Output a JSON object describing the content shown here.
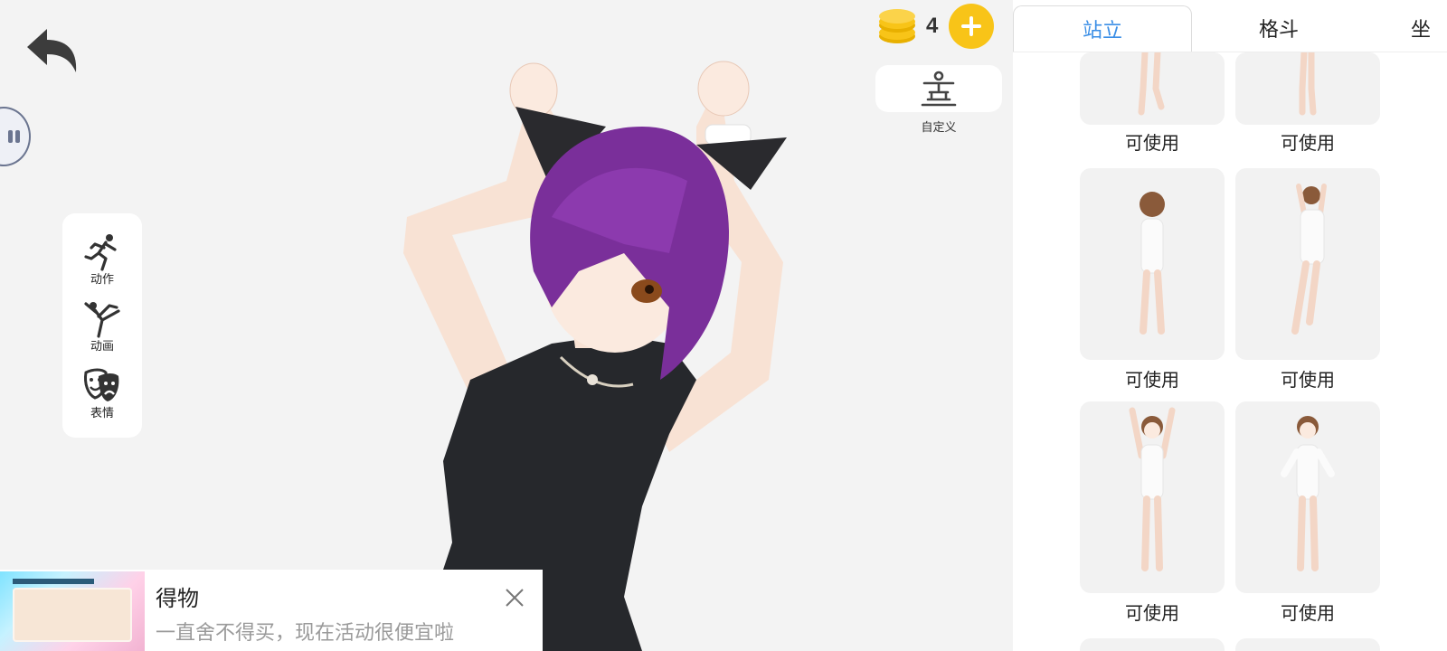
{
  "toolbar": {
    "items": [
      {
        "label": "动作",
        "icon": "running-figure-icon"
      },
      {
        "label": "动画",
        "icon": "dancing-figure-icon"
      },
      {
        "label": "表情",
        "icon": "theater-mask-icon"
      }
    ]
  },
  "coins": {
    "count": "4",
    "add_icon": "plus-icon"
  },
  "custom": {
    "label": "自定义",
    "icon": "pose-stand-icon"
  },
  "tabs": [
    {
      "label": "站立",
      "active": true
    },
    {
      "label": "格斗",
      "active": false
    },
    {
      "label": "坐",
      "active": false
    }
  ],
  "poses": [
    {
      "label": "可使用"
    },
    {
      "label": "可使用"
    },
    {
      "label": "可使用"
    },
    {
      "label": "可使用"
    },
    {
      "label": "可使用"
    },
    {
      "label": "可使用"
    }
  ],
  "ad": {
    "title": "得物",
    "subtitle": "一直舍不得买，现在活动很便宜啦"
  },
  "colors": {
    "accent": "#3a8ee6",
    "coin": "#f8c418",
    "hair": "#7a2f9a",
    "dress": "#26282c"
  }
}
